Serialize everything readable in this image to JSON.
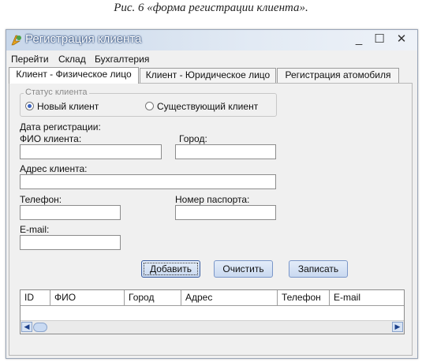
{
  "caption": "Рис. 6 «форма регистрации клиента».",
  "window": {
    "title": "Регистрация клиента",
    "icon": "app-icon",
    "controls": {
      "minimize": "_",
      "maximize": "☐",
      "close": "✕"
    }
  },
  "menu": [
    "Перейти",
    "Склад",
    "Бухгалтерия"
  ],
  "tabs": [
    {
      "label": "Клиент - Физическое лицо",
      "active": true
    },
    {
      "label": "Клиент - Юридическое лицо",
      "active": false
    },
    {
      "label": "Регистрация атомобиля",
      "active": false
    }
  ],
  "status_group": {
    "legend": "Статус клиента",
    "options": [
      {
        "label": "Новый клиент",
        "selected": true
      },
      {
        "label": "Существующий клиент",
        "selected": false
      }
    ]
  },
  "form": {
    "registration_date_label": "Дата регистрации:",
    "fio_label": "ФИО клиента:",
    "fio_value": "",
    "city_label": "Город:",
    "city_value": "",
    "address_label": "Адрес клиента:",
    "address_value": "",
    "phone_label": "Телефон:",
    "phone_value": "",
    "passport_label": "Номер паспорта:",
    "passport_value": "",
    "email_label": "E-mail:",
    "email_value": ""
  },
  "buttons": {
    "add": "Добавить",
    "clear": "Очистить",
    "save": "Записать"
  },
  "grid": {
    "columns": [
      "ID",
      "ФИО",
      "Город",
      "Адрес",
      "Телефон",
      "E-mail"
    ],
    "rows": []
  },
  "colors": {
    "title_gradient_start": "#c8d7ea",
    "button_face": "#c9d9f0",
    "window_bg": "#f0f0f0"
  }
}
